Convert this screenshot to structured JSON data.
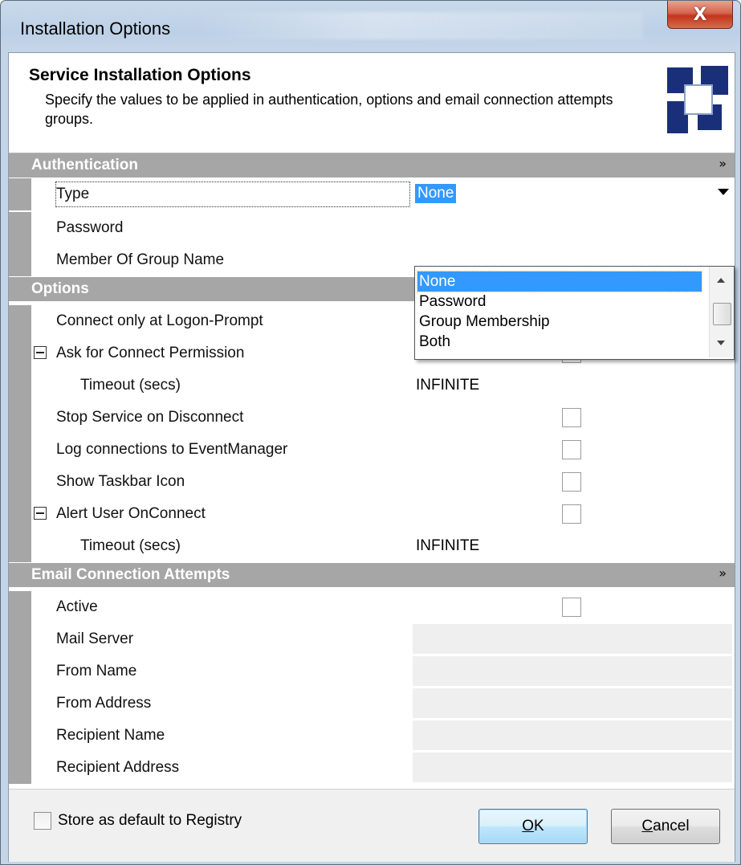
{
  "window": {
    "title": "Installation Options",
    "close_glyph": "X"
  },
  "header": {
    "title": "Service Installation Options",
    "description": "Specify the values to be applied in authentication, options and email connection attempts groups."
  },
  "categories": {
    "authentication": "Authentication",
    "options": "Options",
    "email": "Email Connection Attempts",
    "chevron": "»"
  },
  "auth": {
    "type_label": "Type",
    "type_value": "None",
    "password_label": "Password",
    "group_label": "Member Of Group Name",
    "dropdown_options": [
      "None",
      "Password",
      "Group Membership",
      "Both"
    ]
  },
  "options": {
    "connect_logon": "Connect only at Logon-Prompt",
    "ask_permission": "Ask for Connect Permission",
    "ask_timeout_label": "Timeout (secs)",
    "ask_timeout_value": "INFINITE",
    "stop_service": "Stop Service on Disconnect",
    "log_connections": "Log connections to EventManager",
    "show_taskbar": "Show Taskbar Icon",
    "alert_user": "Alert User OnConnect",
    "alert_timeout_label": "Timeout (secs)",
    "alert_timeout_value": "INFINITE"
  },
  "email": {
    "active": "Active",
    "mail_server": "Mail Server",
    "from_name": "From Name",
    "from_address": "From Address",
    "recipient_name": "Recipient Name",
    "recipient_address": "Recipient Address"
  },
  "footer": {
    "store_label": "Store as default to Registry",
    "ok_accel": "O",
    "ok_rest": "K",
    "cancel_accel": "C",
    "cancel_rest": "ancel"
  },
  "colors": {
    "category_bg": "#a6a6a6",
    "selection": "#3399ff",
    "close_button": "#c2351c"
  }
}
